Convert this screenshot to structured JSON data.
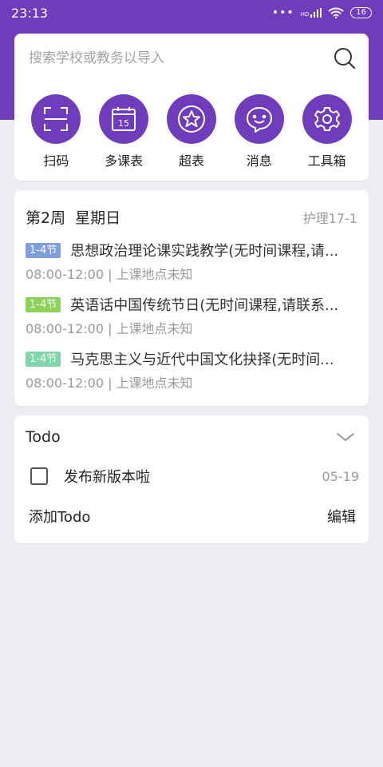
{
  "status": {
    "time": "23:13",
    "signal_text": "HD",
    "battery": "16"
  },
  "search": {
    "placeholder": "搜索学校或教务以导入"
  },
  "shortcuts": [
    {
      "label": "扫码",
      "icon": "scan-icon"
    },
    {
      "label": "多课表",
      "icon": "calendar-icon",
      "icon_text": "15"
    },
    {
      "label": "超表",
      "icon": "star-icon"
    },
    {
      "label": "消息",
      "icon": "message-icon"
    },
    {
      "label": "工具箱",
      "icon": "gear-icon"
    }
  ],
  "week": {
    "title": "第2周  星期日",
    "class_name": "护理17-1",
    "courses": [
      {
        "badge": "1-4节",
        "badge_color": "#7f9fdb",
        "name": "思想政治理论课实践教学(无时间课程,请...",
        "meta": "08:00-12:00 | 上课地点未知"
      },
      {
        "badge": "1-4节",
        "badge_color": "#8fd15a",
        "name": "英语话中国传统节日(无时间课程,请联系...",
        "meta": "08:00-12:00 | 上课地点未知"
      },
      {
        "badge": "1-4节",
        "badge_color": "#7fd6a6",
        "name": "马克思主义与近代中国文化抉择(无时间...",
        "meta": "08:00-12:00 | 上课地点未知"
      }
    ]
  },
  "todo": {
    "title": "Todo",
    "items": [
      {
        "text": "发布新版本啦",
        "date": "05-19",
        "checked": false
      }
    ],
    "add_label": "添加Todo",
    "edit_label": "编辑"
  },
  "colors": {
    "brand": "#6f3cbc",
    "background": "#eceef1"
  }
}
